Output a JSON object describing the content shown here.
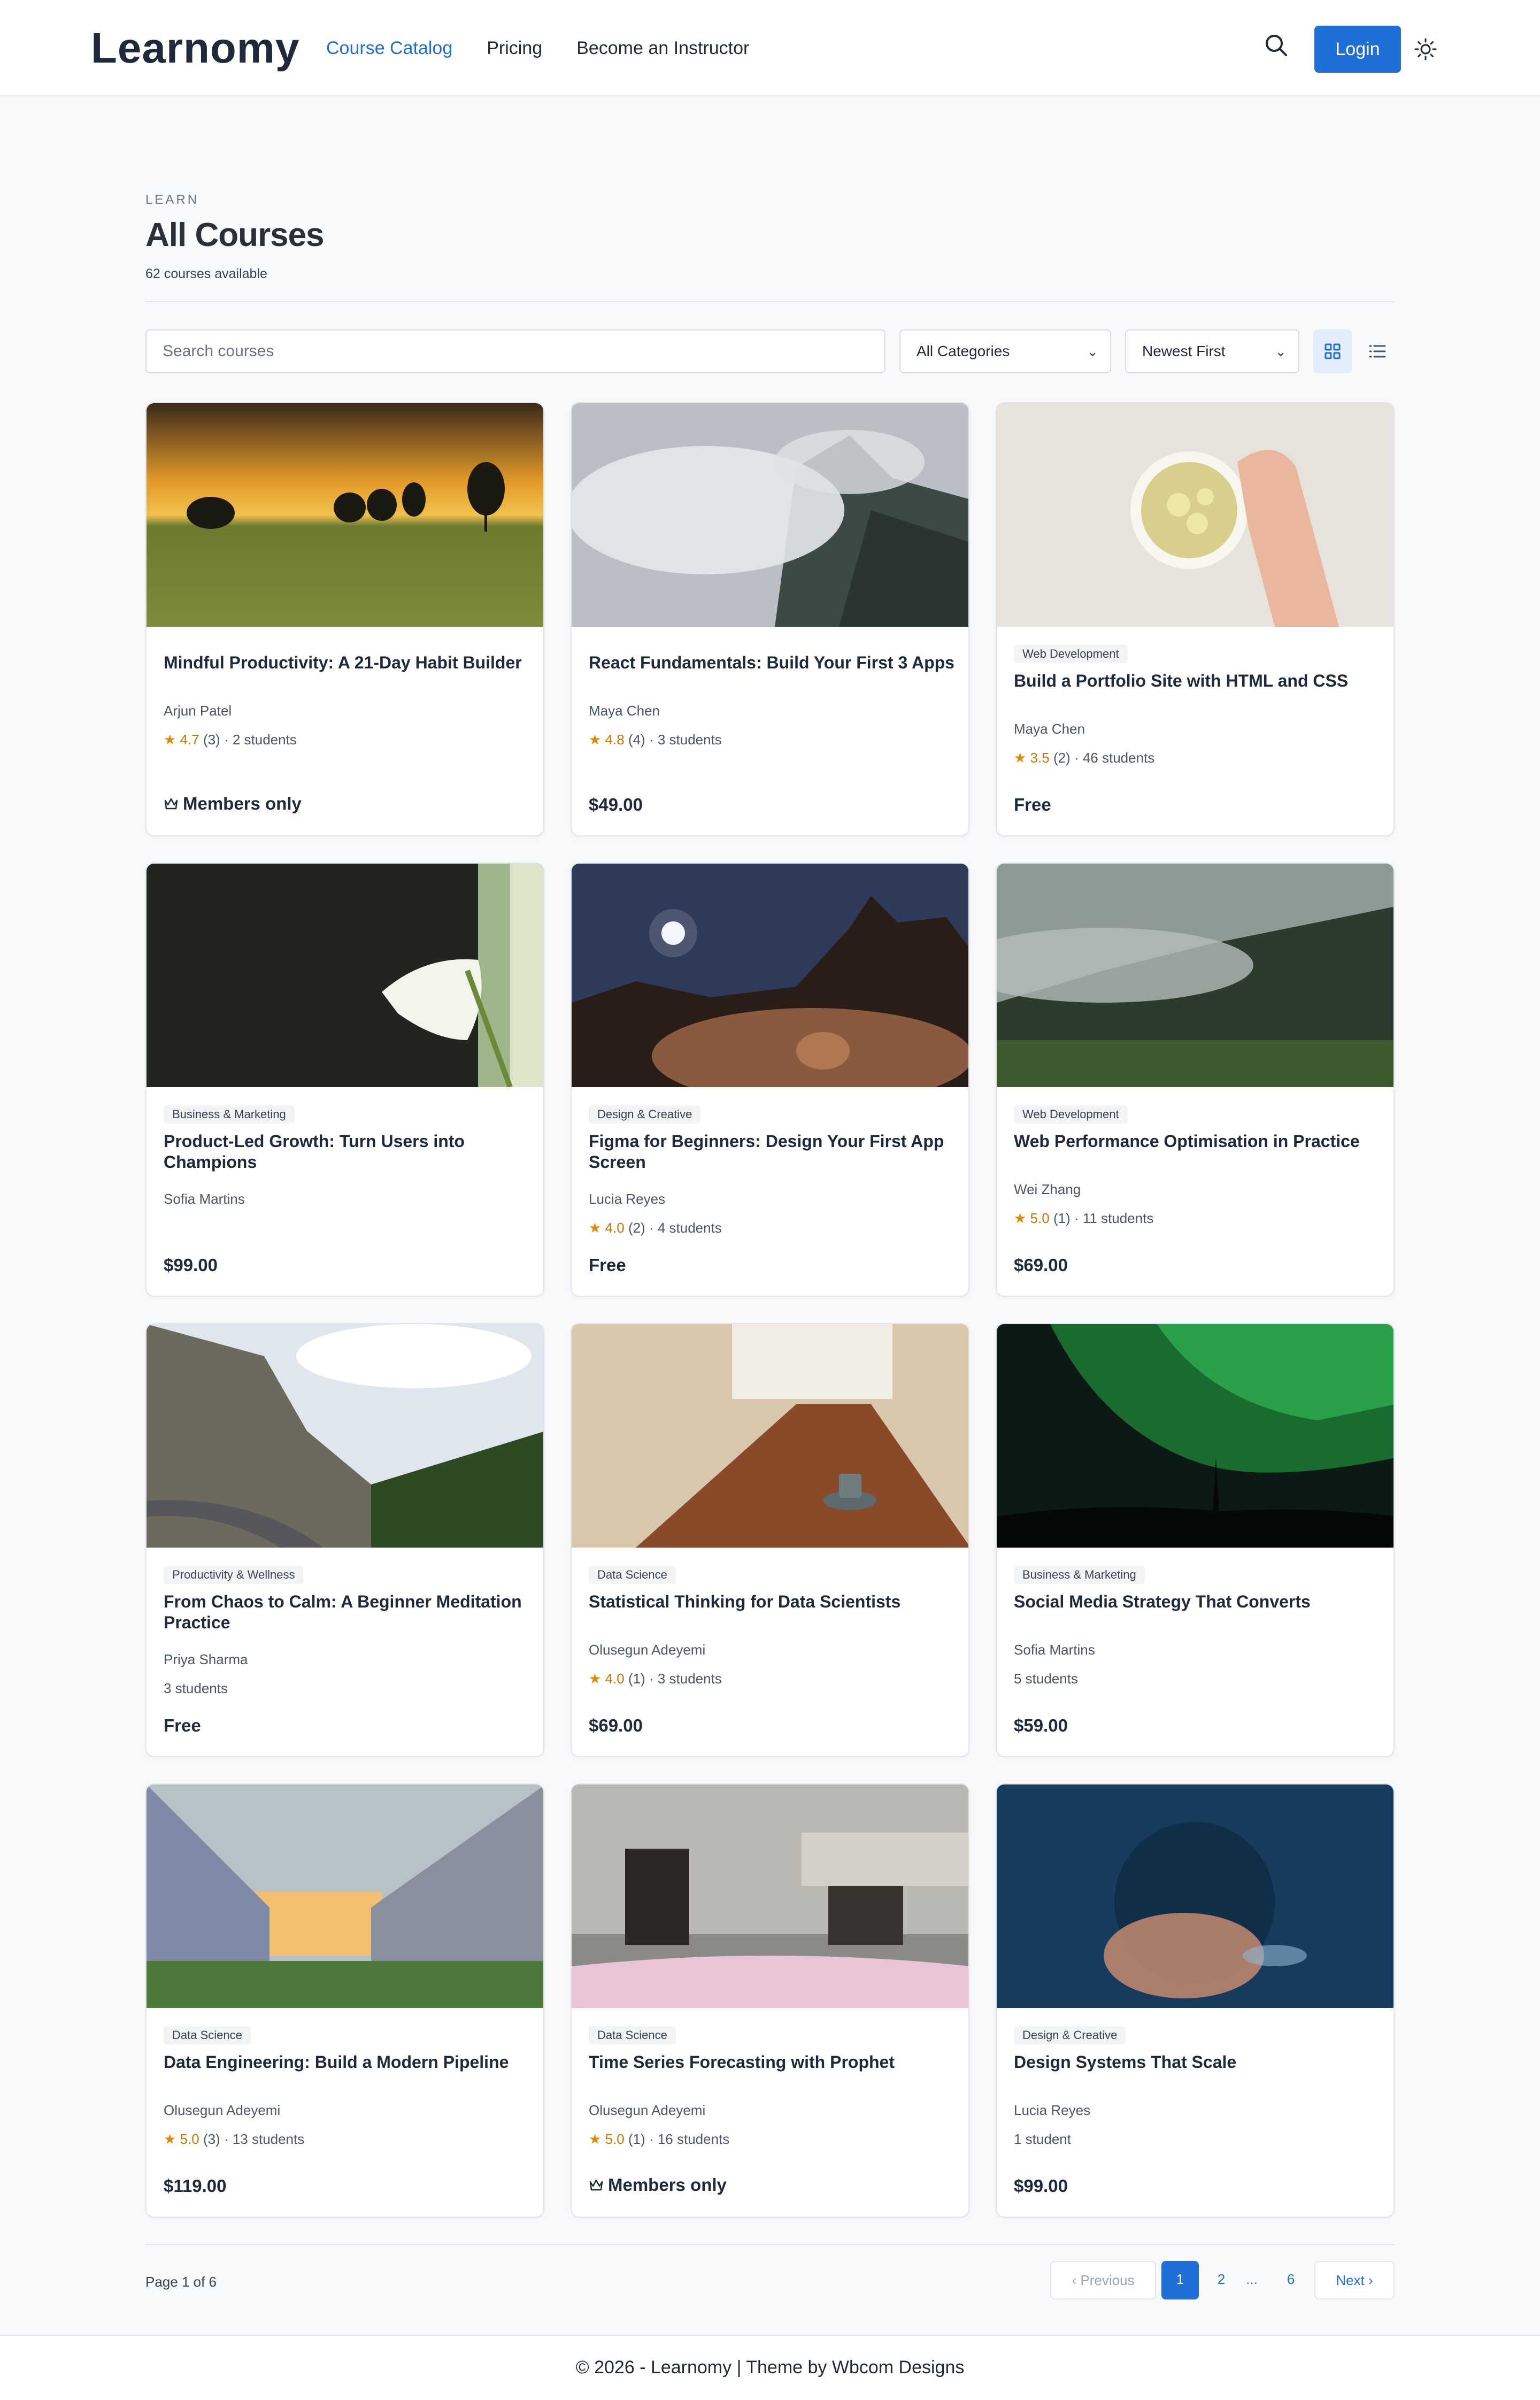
{
  "header": {
    "logo": "Learnomy",
    "nav": [
      "Course Catalog",
      "Pricing",
      "Become an Instructor"
    ],
    "login_label": "Login",
    "accent": "#1f6fd6"
  },
  "page": {
    "eyebrow": "LEARN",
    "title": "All Courses",
    "count": "62 courses available"
  },
  "toolbar": {
    "search_placeholder": "Search courses",
    "category_value": "All Categories",
    "sort_value": "Newest First"
  },
  "courses": [
    {
      "category": "",
      "title": "Mindful Productivity: A 21-Day Habit Builder",
      "instructor": "Arjun Patel",
      "rating": "4.7",
      "reviews": "(3)",
      "students": "2 students",
      "price": "Members only",
      "thumb": "sunset-field"
    },
    {
      "category": "",
      "title": "React Fundamentals: Build Your First 3 Apps",
      "instructor": "Maya Chen",
      "rating": "4.8",
      "reviews": "(4)",
      "students": "3 students",
      "price": "$49.00",
      "thumb": "misty-mountain"
    },
    {
      "category": "Web Development",
      "title": "Build a Portfolio Site with HTML and CSS",
      "instructor": "Maya Chen",
      "rating": "3.5",
      "reviews": "(2)",
      "students": "46 students",
      "price": "Free",
      "thumb": "tea-cup"
    },
    {
      "category": "Business & Marketing",
      "title": "Product-Led Growth: Turn Users into Champions",
      "instructor": "Sofia Martins",
      "rating": "",
      "reviews": "",
      "students": "",
      "price": "$99.00",
      "thumb": "calla-lily"
    },
    {
      "category": "Design & Creative",
      "title": "Figma for Beginners: Design Your First App Screen",
      "instructor": "Lucia Reyes",
      "rating": "4.0",
      "reviews": "(2)",
      "students": "4 students",
      "price": "Free",
      "thumb": "desert-night"
    },
    {
      "category": "Web Development",
      "title": "Web Performance Optimisation in Practice",
      "instructor": "Wei Zhang",
      "rating": "5.0",
      "reviews": "(1)",
      "students": "11 students",
      "price": "$69.00",
      "thumb": "foggy-forest"
    },
    {
      "category": "Productivity & Wellness",
      "title": "From Chaos to Calm: A Beginner Meditation Practice",
      "instructor": "Priya Sharma",
      "rating": "",
      "reviews": "",
      "students": "3 students",
      "price": "Free",
      "thumb": "mountain-road"
    },
    {
      "category": "Data Science",
      "title": "Statistical Thinking for Data Scientists",
      "instructor": "Olusegun Adeyemi",
      "rating": "4.0",
      "reviews": "(1)",
      "students": "3 students",
      "price": "$69.00",
      "thumb": "cafe-table"
    },
    {
      "category": "Business & Marketing",
      "title": "Social Media Strategy That Converts",
      "instructor": "Sofia Martins",
      "rating": "",
      "reviews": "",
      "students": "5 students",
      "price": "$59.00",
      "thumb": "aurora"
    },
    {
      "category": "Data Science",
      "title": "Data Engineering: Build a Modern Pipeline",
      "instructor": "Olusegun Adeyemi",
      "rating": "5.0",
      "reviews": "(3)",
      "students": "13 students",
      "price": "$119.00",
      "thumb": "tree-avenue"
    },
    {
      "category": "Data Science",
      "title": "Time Series Forecasting with Prophet",
      "instructor": "Olusegun Adeyemi",
      "rating": "5.0",
      "reviews": "(1)",
      "students": "16 students",
      "price": "Members only",
      "thumb": "old-building"
    },
    {
      "category": "Design & Creative",
      "title": "Design Systems That Scale",
      "instructor": "Lucia Reyes",
      "rating": "",
      "reviews": "",
      "students": "1 student",
      "price": "$99.00",
      "thumb": "underwater"
    }
  ],
  "pagination": {
    "info": "Page 1 of 6",
    "prev": "Previous",
    "pages": [
      "1",
      "2",
      "...",
      "6"
    ],
    "next": "Next"
  },
  "footer": {
    "text": "© 2026 - Learnomy | Theme by Wbcom Designs"
  }
}
